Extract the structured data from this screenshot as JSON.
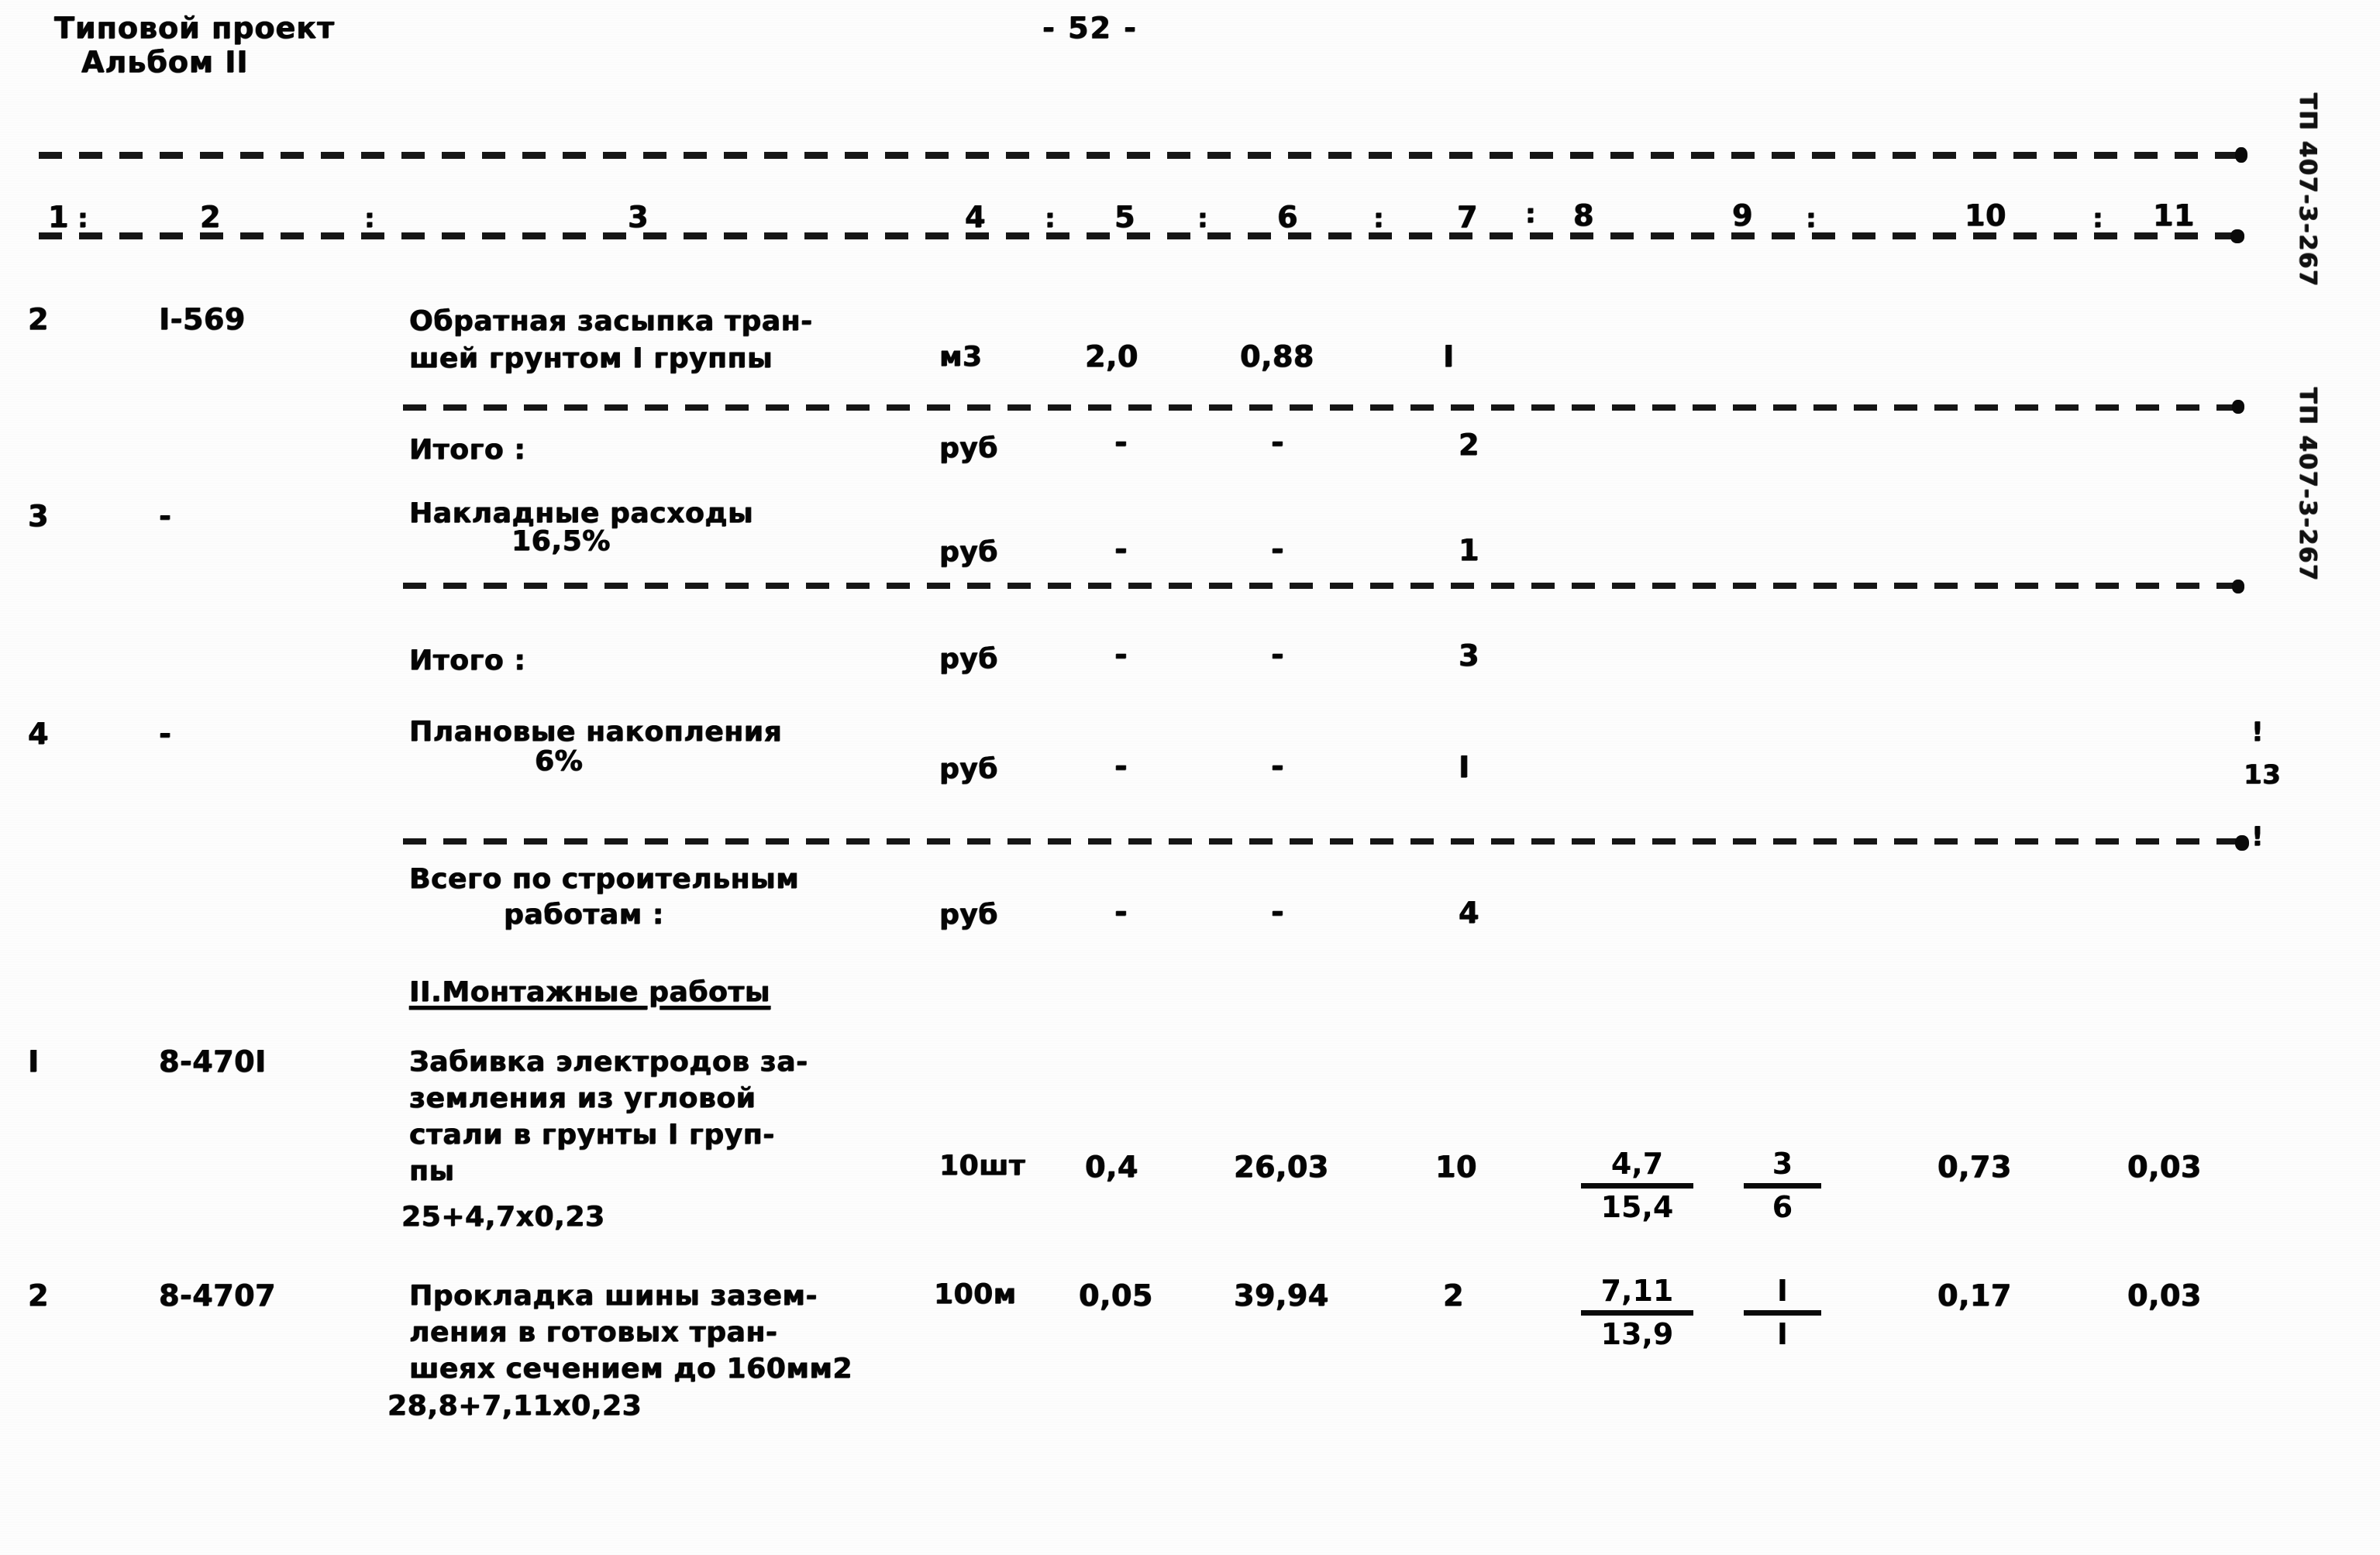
{
  "document": {
    "header_line1": "Типовой проект",
    "header_line2": "Альбом II",
    "page_number": "- 52 -",
    "right_margin_stamp_top": "ТП 407-3-267",
    "right_margin_stamp_bottom": "ТП 407-3-267",
    "right_margin_marks": [
      "!",
      "13",
      "!"
    ]
  },
  "table": {
    "column_numbers": [
      "1",
      "2",
      "3",
      "4",
      "5",
      "6",
      "7",
      "8",
      "9",
      "10",
      "11"
    ],
    "column_separator": ":",
    "rows": [
      {
        "pos": "2",
        "code": "I-569",
        "description_lines": [
          "Обратная засыпка тран-",
          "шей грунтом I группы"
        ],
        "unit": "м3",
        "c5": "2,0",
        "c6": "0,88",
        "c7": "I",
        "c8_num": "",
        "c8_den": "",
        "c9_num": "",
        "c9_den": "",
        "c10": "",
        "c11": ""
      },
      {
        "pos": "",
        "code": "",
        "description_lines": [
          "Итого :"
        ],
        "unit": "руб",
        "c5": "-",
        "c6": "-",
        "c7": "2",
        "c8_num": "",
        "c8_den": "",
        "c9_num": "",
        "c9_den": "",
        "c10": "",
        "c11": ""
      },
      {
        "pos": "3",
        "code": "-",
        "description_lines": [
          "Накладные расходы",
          "16,5%"
        ],
        "unit": "руб",
        "c5": "-",
        "c6": "-",
        "c7": "1",
        "c8_num": "",
        "c8_den": "",
        "c9_num": "",
        "c9_den": "",
        "c10": "",
        "c11": ""
      },
      {
        "pos": "",
        "code": "",
        "description_lines": [
          "Итого :"
        ],
        "unit": "руб",
        "c5": "-",
        "c6": "-",
        "c7": "3",
        "c8_num": "",
        "c8_den": "",
        "c9_num": "",
        "c9_den": "",
        "c10": "",
        "c11": ""
      },
      {
        "pos": "4",
        "code": "-",
        "description_lines": [
          "Плановые накопления",
          "6%"
        ],
        "unit": "руб",
        "c5": "-",
        "c6": "-",
        "c7": "I",
        "c8_num": "",
        "c8_den": "",
        "c9_num": "",
        "c9_den": "",
        "c10": "",
        "c11": ""
      },
      {
        "pos": "",
        "code": "",
        "description_lines": [
          "Всего по строительным",
          "работам :"
        ],
        "unit": "руб",
        "c5": "-",
        "c6": "-",
        "c7": "4",
        "c8_num": "",
        "c8_den": "",
        "c9_num": "",
        "c9_den": "",
        "c10": "",
        "c11": ""
      },
      {
        "pos": "I",
        "code": "8-470I",
        "description_lines": [
          "Забивка электродов за-",
          "земления из угловой",
          "стали в грунты I груп-",
          "пы"
        ],
        "formula": "25+4,7х0,23",
        "unit": "10шт",
        "c5": "0,4",
        "c6": "26,03",
        "c7": "10",
        "c8_num": "4,7",
        "c8_den": "15,4",
        "c9_num": "3",
        "c9_den": "6",
        "c10": "0,73",
        "c11": "0,03"
      },
      {
        "pos": "2",
        "code": "8-4707",
        "description_lines": [
          "Прокладка шины зазем-",
          "ления в готовых тран-",
          "шеях сечением до 160мм2"
        ],
        "formula": "28,8+7,11х0,23",
        "unit": "100м",
        "c5": "0,05",
        "c6": "39,94",
        "c7": "2",
        "c8_num": "7,11",
        "c8_den": "13,9",
        "c9_num": "I",
        "c9_den": "I",
        "c10": "0,17",
        "c11": "0,03"
      }
    ],
    "section_title": "II.Монтажные работы"
  }
}
